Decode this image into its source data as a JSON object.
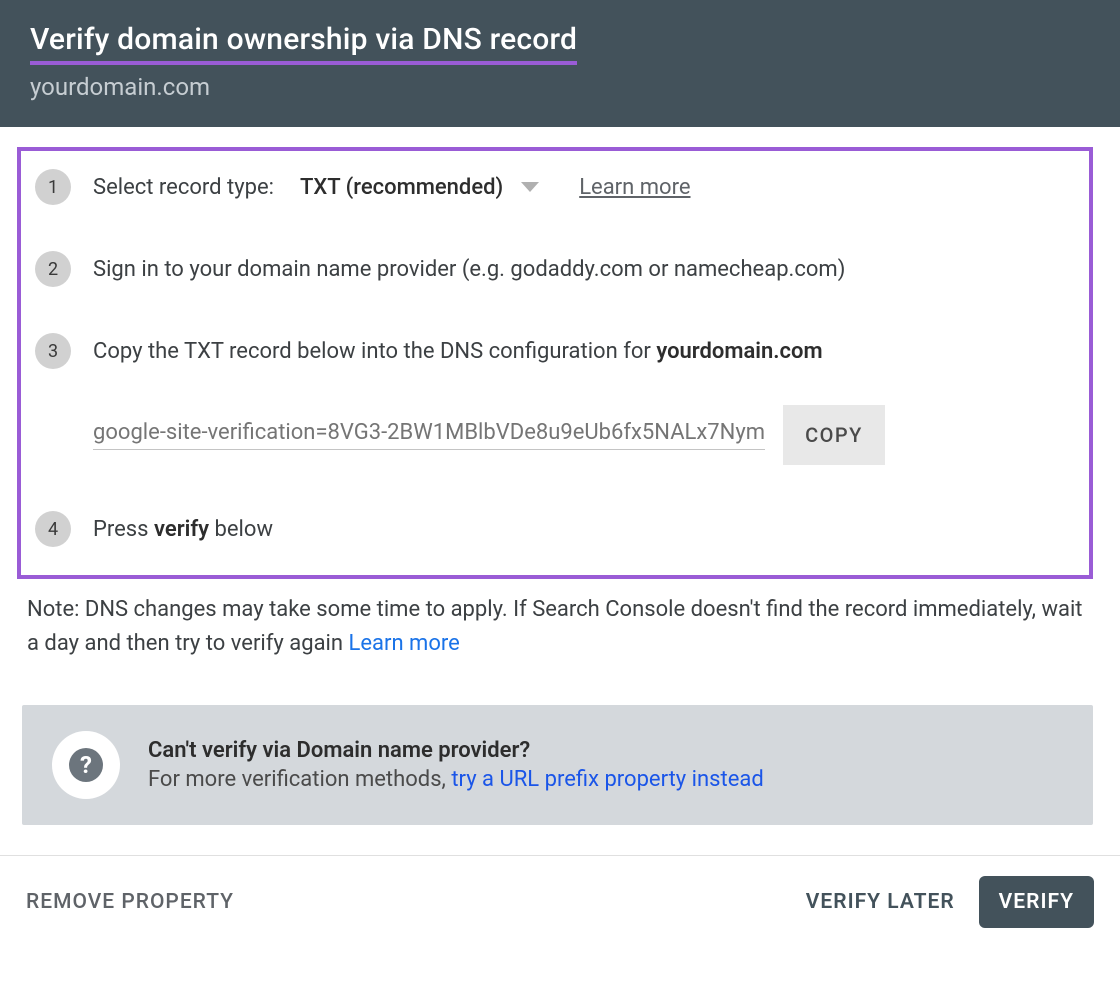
{
  "header": {
    "title": "Verify domain ownership via DNS record",
    "subtitle": "yourdomain.com"
  },
  "steps": {
    "s1": {
      "num": "1",
      "label": "Select record type:",
      "select_value": "TXT (recommended)",
      "learn_more": "Learn more"
    },
    "s2": {
      "num": "2",
      "text": "Sign in to your domain name provider (e.g. godaddy.com or namecheap.com)"
    },
    "s3": {
      "num": "3",
      "prefix": "Copy the TXT record below into the DNS configuration for ",
      "domain": "yourdomain.com",
      "txt_value": "google-site-verification=8VG3-2BW1MBlbVDe8u9eUb6fx5NALx7Nym",
      "copy_label": "COPY"
    },
    "s4": {
      "num": "4",
      "prefix": "Press ",
      "bold": "verify",
      "suffix": " below"
    }
  },
  "note": {
    "text": "Note: DNS changes may take some time to apply. If Search Console doesn't find the record immediately, wait a day and then try to verify again ",
    "link": "Learn more"
  },
  "alt": {
    "title": "Can't verify via Domain name provider?",
    "prefix": "For more verification methods, ",
    "link": "try a URL prefix property instead",
    "help_glyph": "?"
  },
  "footer": {
    "remove": "REMOVE PROPERTY",
    "verify_later": "VERIFY LATER",
    "verify": "VERIFY"
  }
}
